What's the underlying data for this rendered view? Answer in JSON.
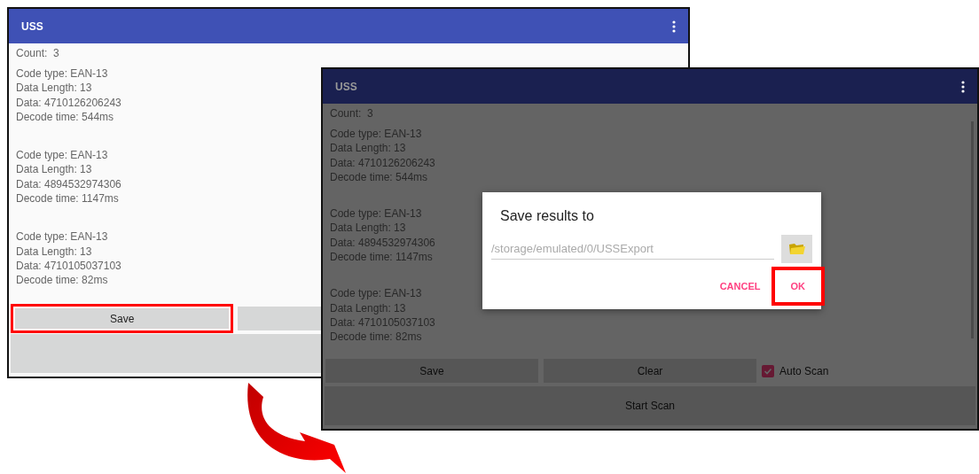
{
  "screenshots": [
    {
      "title": "USS",
      "dimmed": false,
      "count": "Count:  3",
      "results": [
        [
          "Code type: EAN-13",
          "Data Length: 13",
          "Data: 4710126206243",
          "Decode time: 544ms"
        ],
        [
          "Code type: EAN-13",
          "Data Length: 13",
          "Data: 4894532974306",
          "Decode time: 1147ms"
        ],
        [
          "Code type: EAN-13",
          "Data Length: 13",
          "Data: 4710105037103",
          "Decode time: 82ms"
        ]
      ],
      "buttons": [
        {
          "label": "Save",
          "highlighted": true
        },
        {
          "highlighted": false
        }
      ],
      "main_action": {
        "highlighted": false
      }
    },
    {
      "title": "USS",
      "dimmed": true,
      "count": "Count:  3",
      "results": [
        [
          "Code type: EAN-13",
          "Data Length: 13",
          "Data: 4710126206243",
          "Decode time: 544ms"
        ],
        [
          "Code type: EAN-13",
          "Data Length: 13",
          "Data: 4894532974306",
          "Decode time: 1147ms"
        ],
        [
          "Code type: EAN-13",
          "Data Length: 13",
          "Data: 4710105037103",
          "Decode time: 82ms"
        ]
      ],
      "buttons": [
        {
          "label": "Save",
          "highlighted": false
        },
        {
          "label": "Clear",
          "highlighted": false
        }
      ],
      "auto_scan": {
        "label": "Auto Scan",
        "checked": true
      },
      "main_action": {
        "label": "Start Scan",
        "highlighted": false
      },
      "dialog": {
        "title": "Save results to",
        "placeholder": "/storage/emulated/0/USSExport",
        "actions": [
          {
            "label": "CANCEL",
            "highlighted": false
          },
          {
            "label": "OK",
            "highlighted": true
          }
        ]
      }
    }
  ]
}
